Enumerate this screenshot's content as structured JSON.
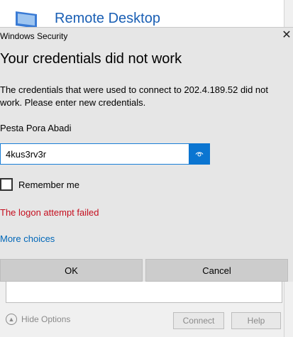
{
  "background": {
    "title": "Remote Desktop",
    "hide_options": "Hide Options",
    "connect_label": "Connect",
    "help_label": "Help"
  },
  "dialog": {
    "window_title": "Windows Security",
    "close_glyph": "✕",
    "heading": "Your credentials did not work",
    "description": "The credentials that were used to connect to 202.4.189.52 did not work. Please enter new credentials.",
    "username": "Pesta Pora Abadi",
    "password_value": "4kus3rv3r",
    "remember_label": "Remember me",
    "error_text": "The logon attempt failed",
    "more_choices": "More choices",
    "ok_label": "OK",
    "cancel_label": "Cancel"
  },
  "colors": {
    "accent": "#0b75d1",
    "error": "#c50f1f",
    "link": "#0067b8"
  }
}
